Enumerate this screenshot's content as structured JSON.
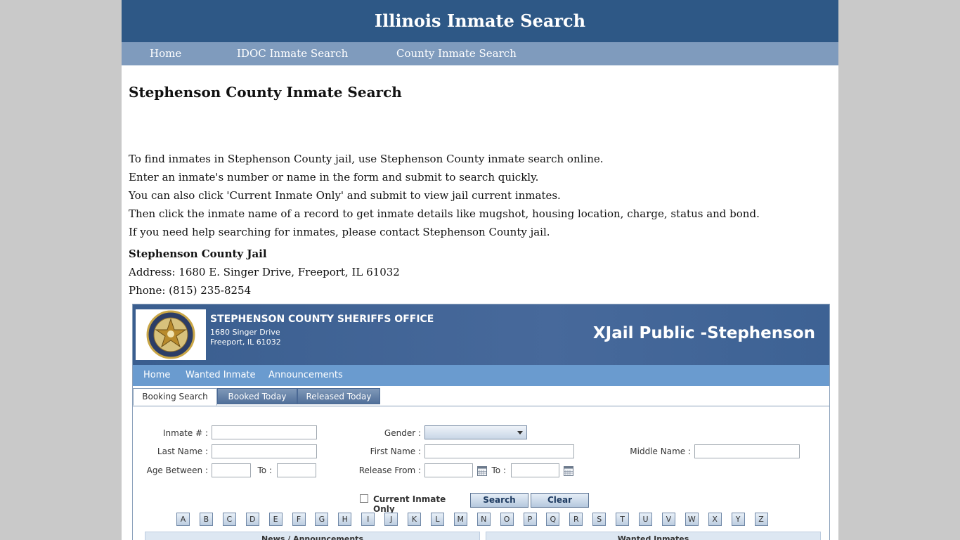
{
  "site": {
    "title": "Illinois Inmate Search",
    "nav": [
      "Home",
      "IDOC Inmate Search",
      "County Inmate Search"
    ]
  },
  "content": {
    "heading": "Stephenson County Inmate Search",
    "paragraphs": [
      "To find inmates in Stephenson County jail, use Stephenson County inmate search online.",
      "Enter an inmate's number or name in the form and submit to search quickly.",
      "You can also click 'Current Inmate Only' and submit to view jail current inmates.",
      "Then click the inmate name of a record to get inmate details like mugshot, housing location, charge, status and bond.",
      "If you need help searching for inmates, please contact Stephenson County jail."
    ],
    "jail_name": "Stephenson County Jail",
    "address": "Address: 1680 E. Singer Drive, Freeport, IL 61032",
    "phone": "Phone: (815) 235-8254"
  },
  "jail_widget": {
    "office_name": "STEPHENSON COUNTY SHERIFFS OFFICE",
    "address_line1": "1680 Singer Drive",
    "address_line2": "Freeport, IL 61032",
    "app_title": "XJail Public -Stephenson",
    "seal_text": "ILLINOIS",
    "nav": [
      "Home",
      "Wanted Inmate",
      "Announcements"
    ],
    "tabs": [
      "Booking Search",
      "Booked Today",
      "Released Today"
    ],
    "active_tab": "Booking Search",
    "form": {
      "inmate_no_label": "Inmate # :",
      "last_name_label": "Last Name :",
      "age_between_label": "Age Between :",
      "to_label": "To :",
      "gender_label": "Gender :",
      "first_name_label": "First Name :",
      "release_from_label": "Release From :",
      "middle_name_label": "Middle Name :",
      "inmate_no_value": "",
      "last_name_value": "",
      "first_name_value": "",
      "middle_name_value": "",
      "age_from_value": "",
      "age_to_value": "",
      "release_from_value": "",
      "release_to_value": "",
      "gender_selected": "",
      "current_inmate_only_label": "Current Inmate Only",
      "current_inmate_only_checked": false,
      "search_button": "Search",
      "clear_button": "Clear"
    },
    "letters": [
      "A",
      "B",
      "C",
      "D",
      "E",
      "F",
      "G",
      "H",
      "I",
      "J",
      "K",
      "L",
      "M",
      "N",
      "O",
      "P",
      "Q",
      "R",
      "S",
      "T",
      "U",
      "V",
      "W",
      "X",
      "Y",
      "Z"
    ],
    "panels": [
      "News / Announcements",
      "Wanted Inmates"
    ]
  },
  "colors": {
    "page_bg": "#c9c9c9",
    "header_bg": "#2e5886",
    "nav_bg": "#7f9bbd",
    "widget_nav_bg": "#6a9bcf"
  }
}
